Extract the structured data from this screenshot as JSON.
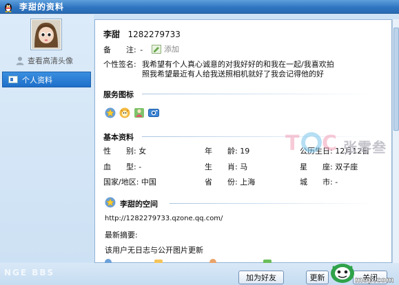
{
  "window": {
    "title": "李甜的资料"
  },
  "sidebar": {
    "hd_avatar_link": "查看高清头像",
    "nav_items": [
      {
        "label": "个人资料",
        "icon": "profile-card-icon",
        "selected": true
      }
    ]
  },
  "profile": {
    "name": "李甜",
    "qq_number": "1282279733",
    "remark_label": "备　　注:",
    "remark_value": "-",
    "remark_add": "添加",
    "signature_label": "个性签名:",
    "signature_line1": "我希望有个人真心诚意的对我好好的和我在一起/我喜欢拍",
    "signature_line2": "照我希望最近有人给我送照相机就好了我会记得他的好"
  },
  "services": {
    "title": "服务图标",
    "icons": [
      "qzone-star-icon",
      "qq-pet-icon",
      "qq-show-icon",
      "qq-photo-icon"
    ]
  },
  "basic_info": {
    "title": "基本资料",
    "rows": [
      [
        {
          "label": "性　　别:",
          "value": "女"
        },
        {
          "label": "年　　龄:",
          "value": "19"
        },
        {
          "label": "公历生日:",
          "value": "12月12日"
        }
      ],
      [
        {
          "label": "血　　型:",
          "value": "-"
        },
        {
          "label": "生　　肖:",
          "value": "马"
        },
        {
          "label": "星　　座:",
          "value": "双子座"
        }
      ],
      [
        {
          "label": "国家/地区:",
          "value": "中国"
        },
        {
          "label": "省　　份:",
          "value": "上海"
        },
        {
          "label": "城　　市:",
          "value": "-"
        }
      ]
    ]
  },
  "qzone": {
    "title": "李甜的空间",
    "url": "http://1282279733.qzone.qq.com/",
    "latest_label": "最新摘要:",
    "latest_text": "该用户无日志与公开图片更新"
  },
  "buttons": {
    "add_friend": "加为好友",
    "update": "更新",
    "close": "关闭"
  },
  "watermarks": {
    "tc_brand": "张零叁",
    "site": "mop.com"
  },
  "colors": {
    "titlebar": "#2d73bf",
    "selected_nav": "#1e6fc9",
    "panel_border": "#8fb2d6"
  }
}
